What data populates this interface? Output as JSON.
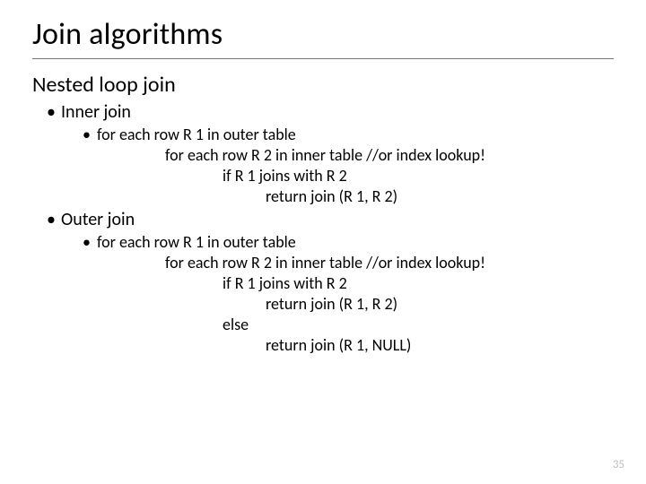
{
  "slide": {
    "title": "Join algorithms",
    "subhead": "Nested loop join",
    "inner": {
      "label": "Inner join",
      "line1": "for each row R 1 in outer table",
      "line2": "for each row R 2 in inner table //or index lookup!",
      "line3": "if R 1 joins with R 2",
      "line4": "return join (R 1, R 2)"
    },
    "outer": {
      "label": "Outer join",
      "line1": "for each row R 1 in outer table",
      "line2": "for each row R 2 in inner table //or index lookup!",
      "line3": "if R 1 joins with R 2",
      "line4": "return join (R 1, R 2)",
      "line5": "else",
      "line6": "return join (R 1, NULL)"
    },
    "page_number": "35"
  }
}
